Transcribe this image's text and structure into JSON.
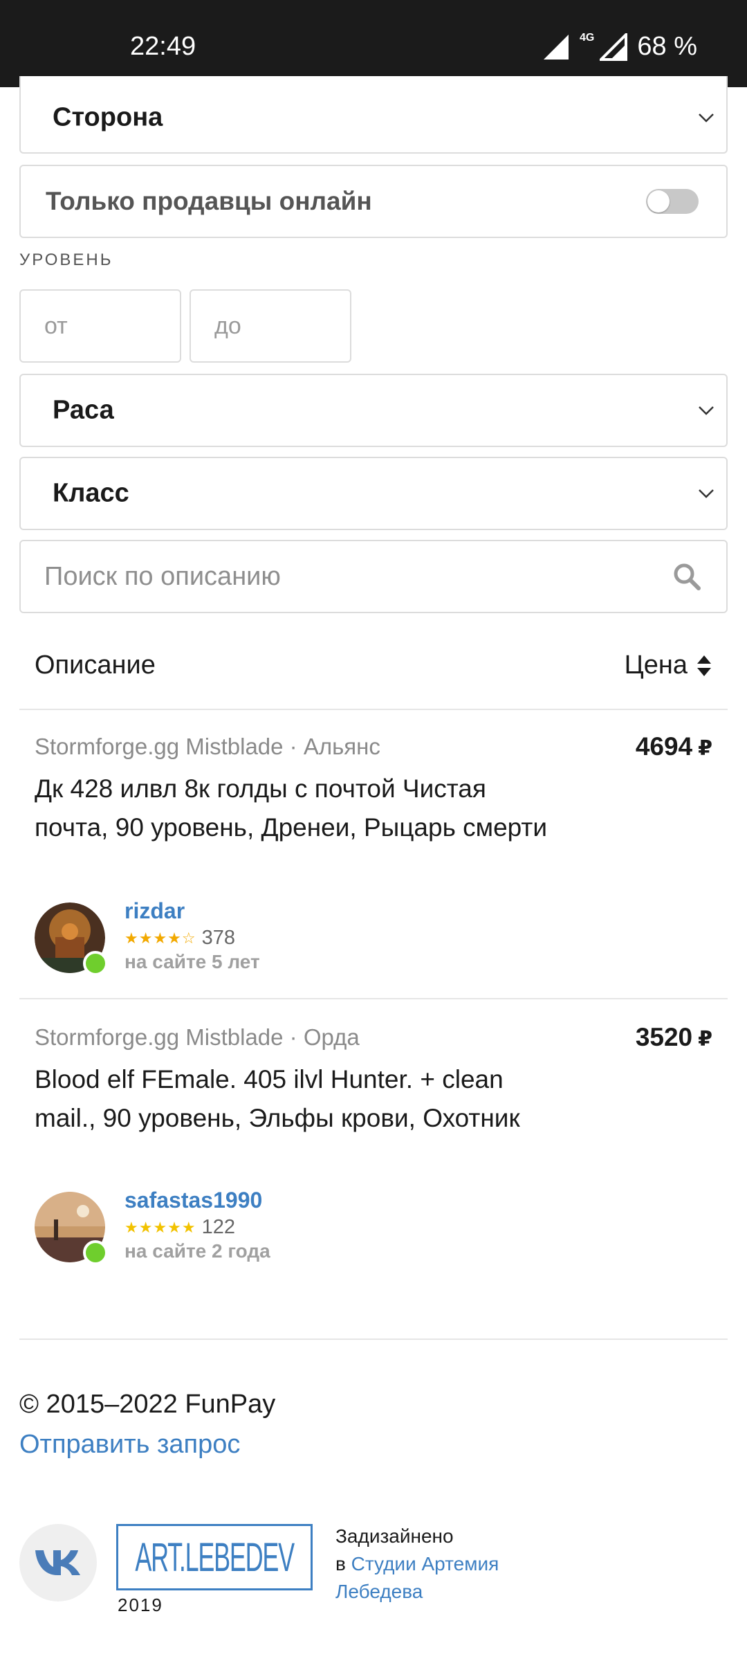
{
  "status_bar": {
    "time": "22:49",
    "network": "4G",
    "battery": "68 %"
  },
  "filters": {
    "side_select": "Сторона",
    "online_toggle_label": "Только продавцы онлайн",
    "online_toggle_on": false,
    "level_label": "УРОВЕНЬ",
    "level_from_placeholder": "от",
    "level_to_placeholder": "до",
    "race_select": "Раса",
    "class_select": "Класс",
    "search_placeholder": "Поиск по описанию"
  },
  "table_header": {
    "description": "Описание",
    "price": "Цена"
  },
  "offers": [
    {
      "server": "Stormforge.gg Mistblade · Альянс",
      "price": "4694",
      "currency": "₽",
      "title": "Дк 428 илвл 8к голды с почтой Чистая почта, 90 уровень, Дренеи, Рыцарь смерти",
      "seller": {
        "name": "rizdar",
        "stars": "★★★★☆",
        "rating": 4,
        "reviews": "378",
        "on_site": "на сайте 5 лет",
        "online": true
      }
    },
    {
      "server": "Stormforge.gg Mistblade · Орда",
      "price": "3520",
      "currency": "₽",
      "title": "Blood elf FEmale. 405 ilvl Hunter. + clean mail., 90 уровень, Эльфы крови, Охотник",
      "seller": {
        "name": "safastas1990",
        "stars": "★★★★★",
        "rating": 5,
        "reviews": "122",
        "on_site": "на сайте 2 года",
        "online": true
      }
    }
  ],
  "footer": {
    "copyright": "© 2015–2022 FunPay",
    "request_link": "Отправить запрос",
    "artlebedev_logo": "ART.LEBEDEV",
    "artlebedev_year": "2019",
    "designed_prefix": "Задизайнено",
    "designed_in": "в",
    "studio_link": "Студии Артемия Лебедева"
  },
  "colors": {
    "link": "#3d7fc2",
    "online": "#6fce2d",
    "star": "#f2a900",
    "status_bar": "#1b1b1b"
  }
}
